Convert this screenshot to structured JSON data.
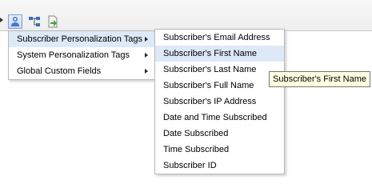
{
  "toolbar": {
    "buttons": [
      {
        "icon": "users-personalize-icon",
        "active": true
      },
      {
        "icon": "sitemap-icon",
        "active": false
      },
      {
        "icon": "insert-arrow-icon",
        "active": false
      }
    ]
  },
  "main_menu": {
    "items": [
      {
        "label": "Subscriber Personalization Tags",
        "has_submenu": true,
        "highlighted": true
      },
      {
        "label": "System Personalization Tags",
        "has_submenu": true,
        "highlighted": false
      },
      {
        "label": "Global Custom Fields",
        "has_submenu": true,
        "highlighted": false
      }
    ]
  },
  "submenu": {
    "items": [
      {
        "label": "Subscriber's Email Address",
        "highlighted": false
      },
      {
        "label": "Subscriber's First Name",
        "highlighted": true
      },
      {
        "label": "Subscriber's Last Name",
        "highlighted": false
      },
      {
        "label": "Subscriber's Full Name",
        "highlighted": false
      },
      {
        "label": "Subscriber's IP Address",
        "highlighted": false
      },
      {
        "label": "Date and Time Subscribed",
        "highlighted": false
      },
      {
        "label": "Date Subscribed",
        "highlighted": false
      },
      {
        "label": "Time Subscribed",
        "highlighted": false
      },
      {
        "label": "Subscriber ID",
        "highlighted": false
      }
    ]
  },
  "tooltip": {
    "text": "Subscriber's First Name"
  },
  "colors": {
    "highlight": "#dde9f7",
    "tooltip_bg": "#ffffe1",
    "menu_border": "#b9b9b9"
  }
}
